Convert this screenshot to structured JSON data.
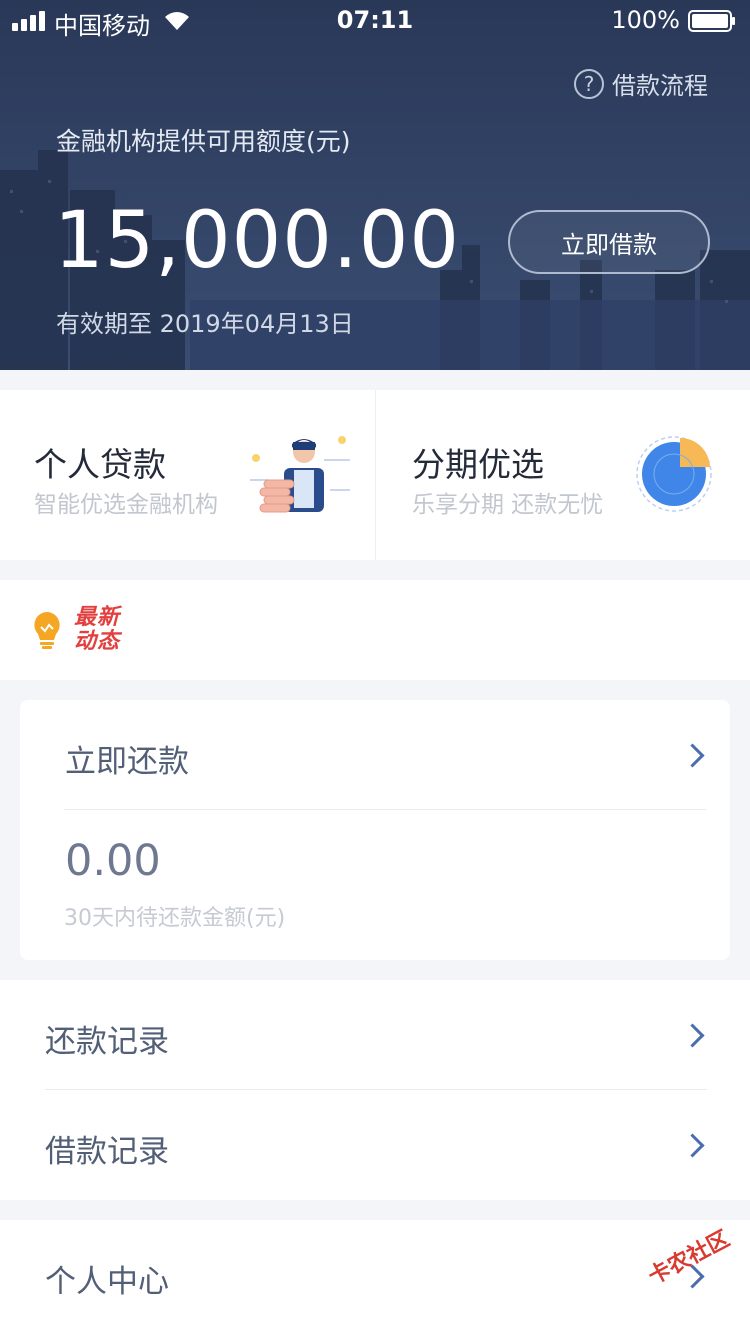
{
  "status_bar": {
    "carrier": "中国移动",
    "time": "07:11",
    "battery": "100%"
  },
  "header": {
    "process_link": "借款流程",
    "credit_label": "金融机构提供可用额度(元)",
    "amount": "15,000.00",
    "validity": "有效期至 2019年04月13日",
    "borrow_button": "立即借款"
  },
  "products": [
    {
      "title": "个人贷款",
      "subtitle": "智能优选金融机构",
      "icon": "person-coins-illustration"
    },
    {
      "title": "分期优选",
      "subtitle": "乐享分期 还款无忧",
      "icon": "pie-chart-illustration"
    }
  ],
  "news": {
    "tag_line1": "最新",
    "tag_line2": "动态",
    "icon": "bulb-icon"
  },
  "repay": {
    "title": "立即还款",
    "amount": "0.00",
    "note": "30天内待还款金额(元)"
  },
  "records": {
    "repay_record": "还款记录",
    "borrow_record": "借款记录"
  },
  "personal_center": "个人中心",
  "watermark": "卡农社区",
  "colors": {
    "header_bg": "#2e3f62",
    "chevron": "#4a6db0",
    "news_red": "#e2403f",
    "bulb_orange": "#f5a623",
    "pie_blue": "#3f86e8",
    "pie_orange": "#f7b955"
  }
}
